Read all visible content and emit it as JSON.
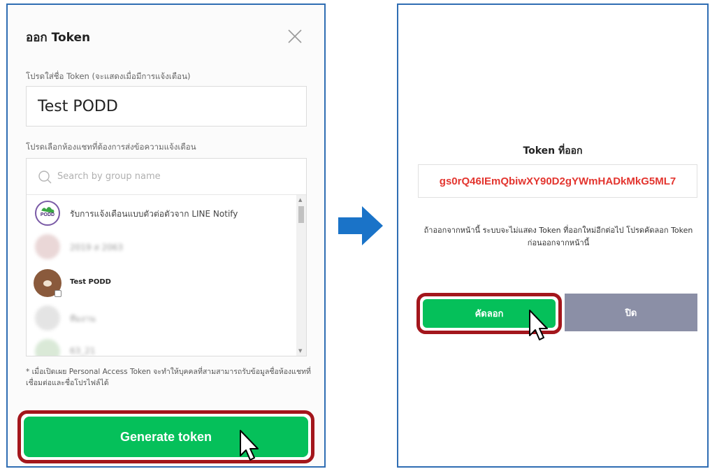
{
  "left_dialog": {
    "title": "ออก Token",
    "name_label": "โปรดใส่ชื่อ Token (จะแสดงเมื่อมีการแจ้งเตือน)",
    "name_value": "Test PODD",
    "select_label": "โปรดเลือกห้องแชทที่ต้องการส่งข้อความแจ้งเตือน",
    "search_placeholder": "Search by group name",
    "groups": [
      {
        "label": "รับการแจ้งเตือนแบบตัวต่อตัวจาก LINE Notify",
        "avatar_text": "PODD"
      },
      {
        "label": "2019 ส 2063"
      },
      {
        "label": "Test PODD"
      },
      {
        "label": "ทีมงาน"
      },
      {
        "label": "63_21"
      }
    ],
    "note": "* เมื่อเปิดเผย Personal Access Token จะทำให้บุคคลที่สามสามารถรับข้อมูลชื่อห้องแชทที่เชื่อมต่อและชื่อโปรไฟล์ได้",
    "generate_label": "Generate token"
  },
  "right_dialog": {
    "title": "Token ที่ออก",
    "token": "gs0rQ46IEmQbiwXY90D2gYWmHADkMkG5ML7",
    "warning": "ถ้าออกจากหน้านี้ ระบบจะไม่แสดง Token ที่ออกใหม่อีกต่อไป โปรดคัดลอก Token ก่อนออกจากหน้านี้",
    "copy_label": "คัดลอก",
    "close_label": "ปิด"
  },
  "colors": {
    "panel_border": "#2f6db3",
    "line_green": "#05c05a",
    "highlight_red": "#a3161c",
    "token_red": "#e3352f",
    "close_gray": "#8b8fa6",
    "arrow_blue": "#1a73c8"
  },
  "icons": [
    "close-icon",
    "search-icon",
    "arrow-right-icon",
    "mouse-cursor-icon"
  ]
}
